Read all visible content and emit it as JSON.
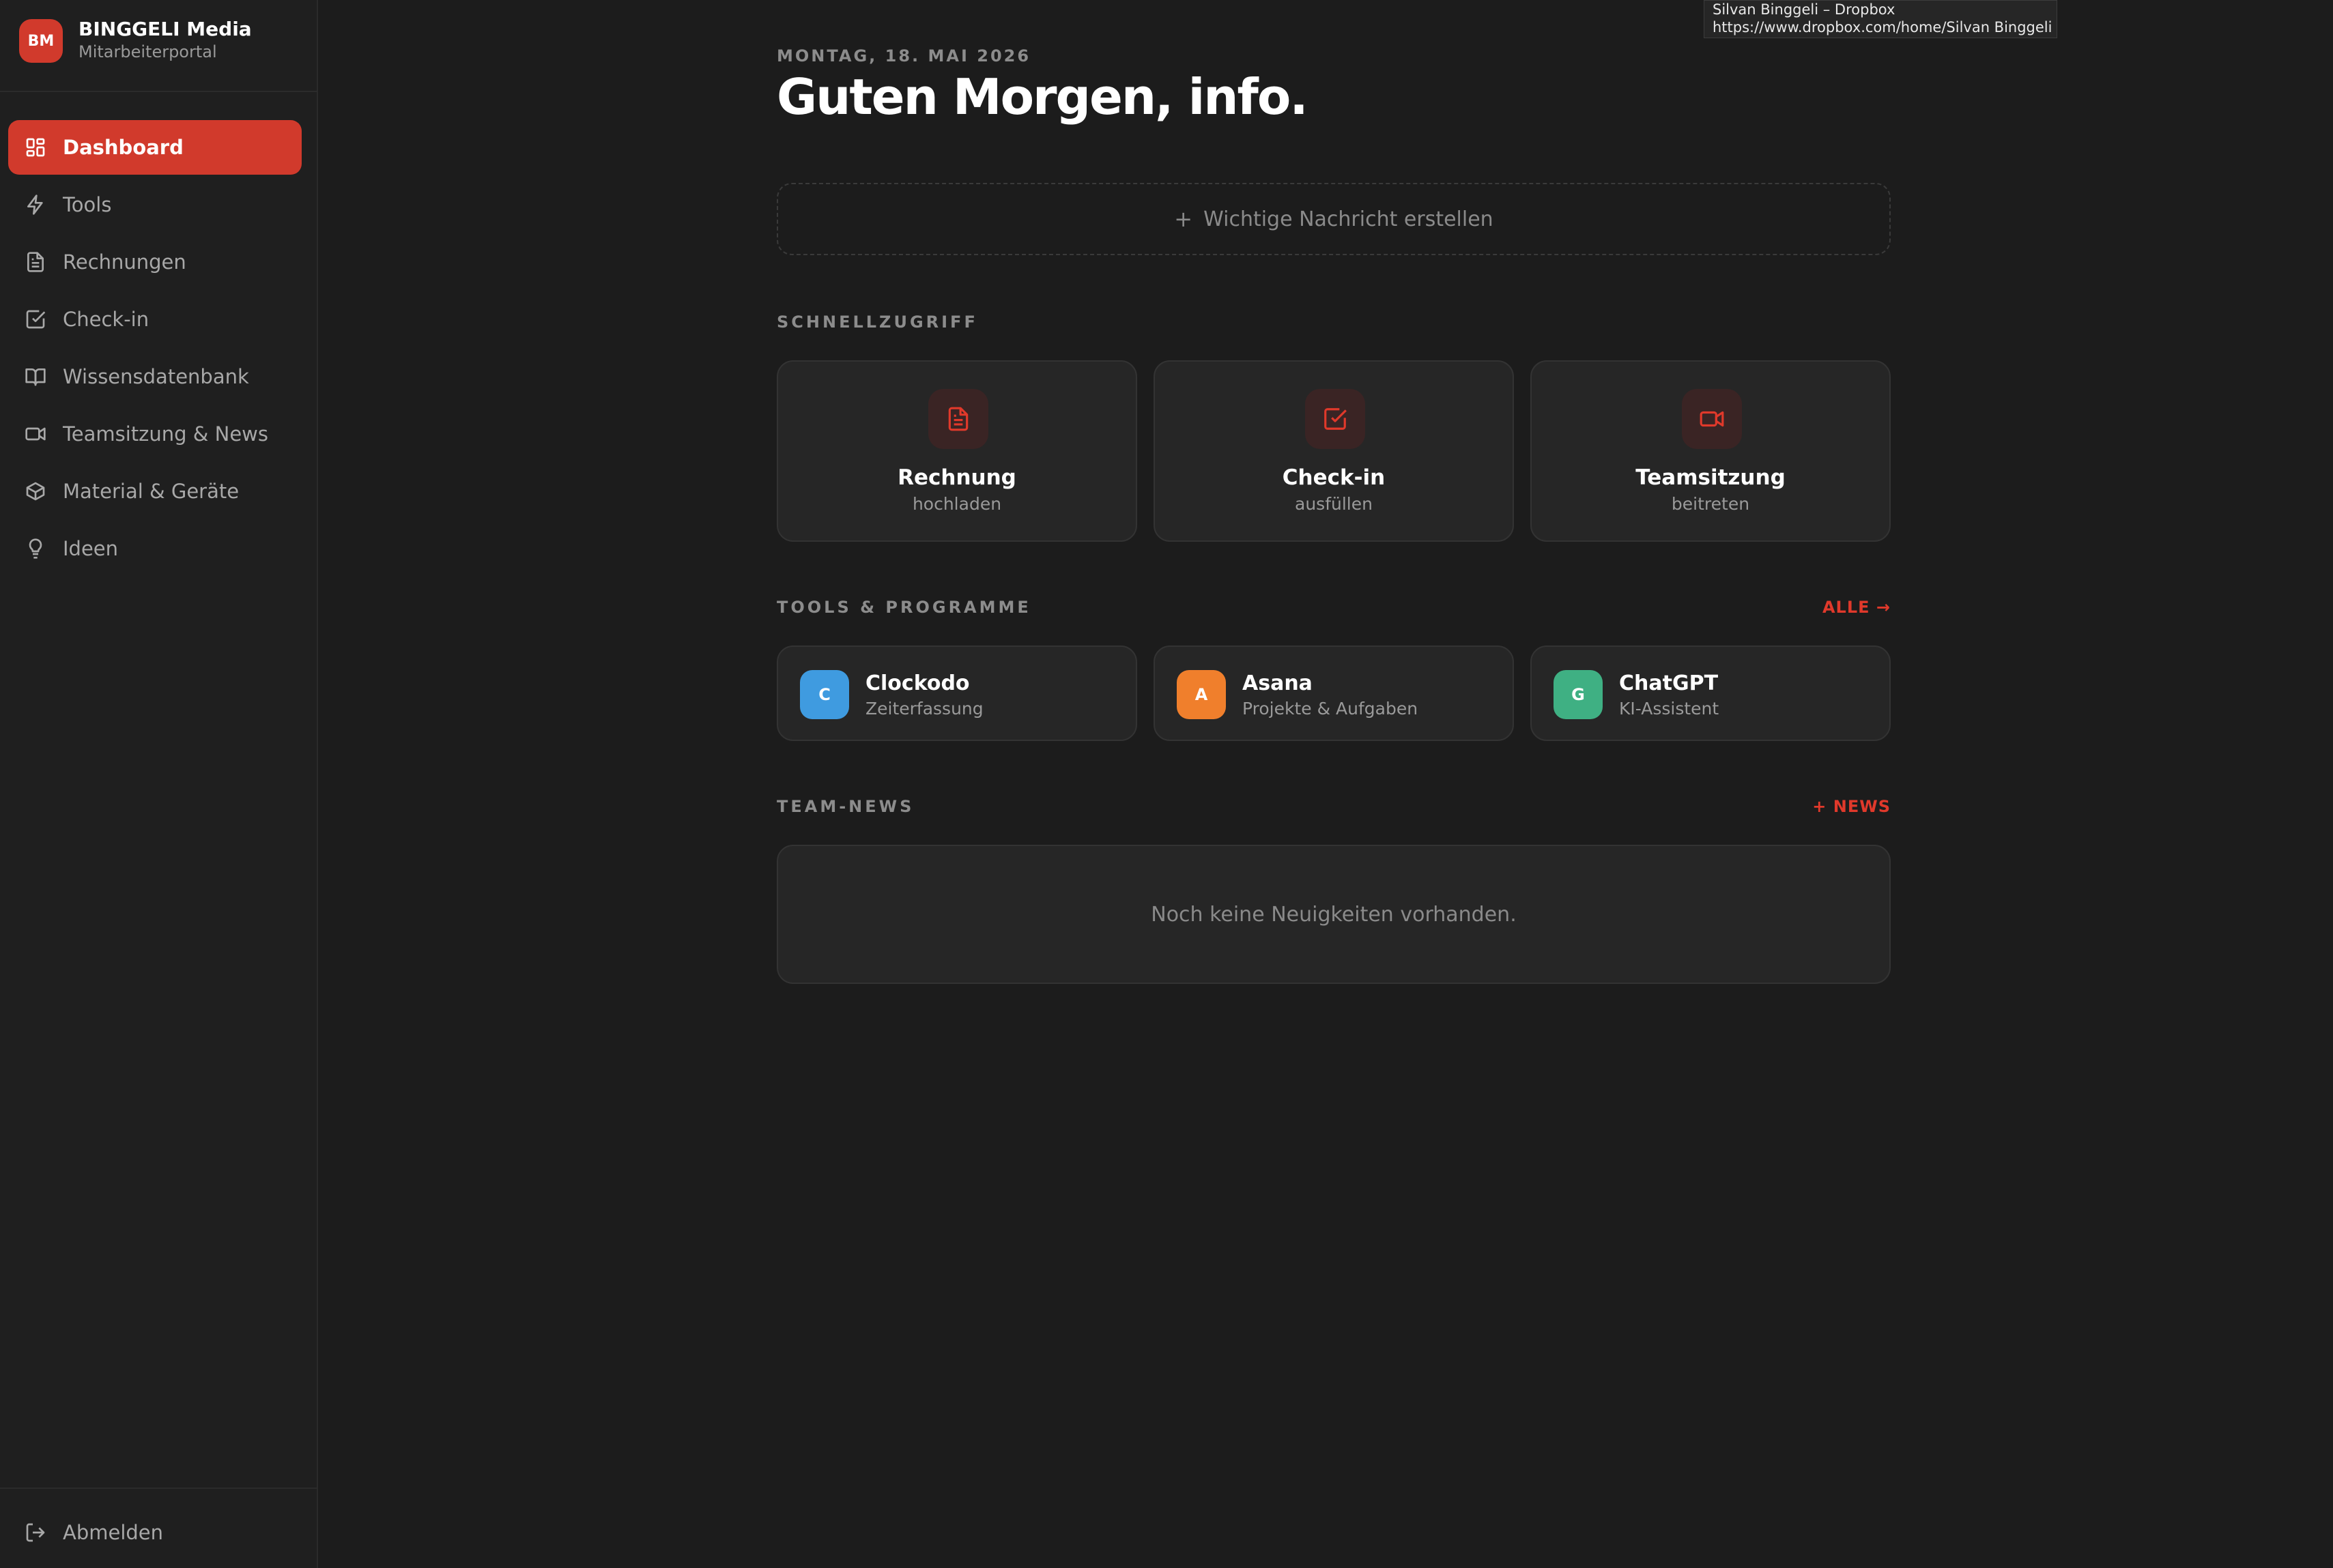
{
  "brand": {
    "logo": "BM",
    "name": "BINGGELI Media",
    "subtitle": "Mitarbeiterportal"
  },
  "nav": {
    "items": [
      {
        "label": "Dashboard",
        "icon": "grid-icon",
        "active": true
      },
      {
        "label": "Tools",
        "icon": "bolt-icon"
      },
      {
        "label": "Rechnungen",
        "icon": "document-icon"
      },
      {
        "label": "Check-in",
        "icon": "checkbox-icon"
      },
      {
        "label": "Wissensdatenbank",
        "icon": "book-icon"
      },
      {
        "label": "Teamsitzung & News",
        "icon": "video-icon"
      },
      {
        "label": "Material & Geräte",
        "icon": "box-icon"
      },
      {
        "label": "Ideen",
        "icon": "lightbulb-icon"
      }
    ],
    "logout": "Abmelden"
  },
  "main": {
    "date": "MONTAG, 18. MAI 2026",
    "greeting": "Guten Morgen, info.",
    "create_message": "Wichtige Nachricht erstellen",
    "quick_access": {
      "label": "SCHNELLZUGRIFF",
      "cards": [
        {
          "title": "Rechnung",
          "subtitle": "hochladen",
          "icon": "document-icon"
        },
        {
          "title": "Check-in",
          "subtitle": "ausfüllen",
          "icon": "checkbox-icon"
        },
        {
          "title": "Teamsitzung",
          "subtitle": "beitreten",
          "icon": "video-icon"
        }
      ]
    },
    "tools": {
      "label": "TOOLS & PROGRAMME",
      "link": "ALLE →",
      "items": [
        {
          "letter": "C",
          "name": "Clockodo",
          "desc": "Zeiterfassung",
          "color": "#3f9be0"
        },
        {
          "letter": "A",
          "name": "Asana",
          "desc": "Projekte & Aufgaben",
          "color": "#f07f2c"
        },
        {
          "letter": "G",
          "name": "ChatGPT",
          "desc": "KI-Assistent",
          "color": "#3fb083"
        }
      ]
    },
    "news": {
      "label": "TEAM-NEWS",
      "link": "+ NEWS",
      "empty": "Noch keine Neuigkeiten vorhanden."
    }
  },
  "tooltip": {
    "title": "Silvan Binggeli – Dropbox",
    "url": "https://www.dropbox.com/home/Silvan Binggeli"
  },
  "colors": {
    "accent": "#d13a2c",
    "background": "#1c1c1c",
    "sidebar": "#1f1f1f",
    "card": "#262626"
  }
}
